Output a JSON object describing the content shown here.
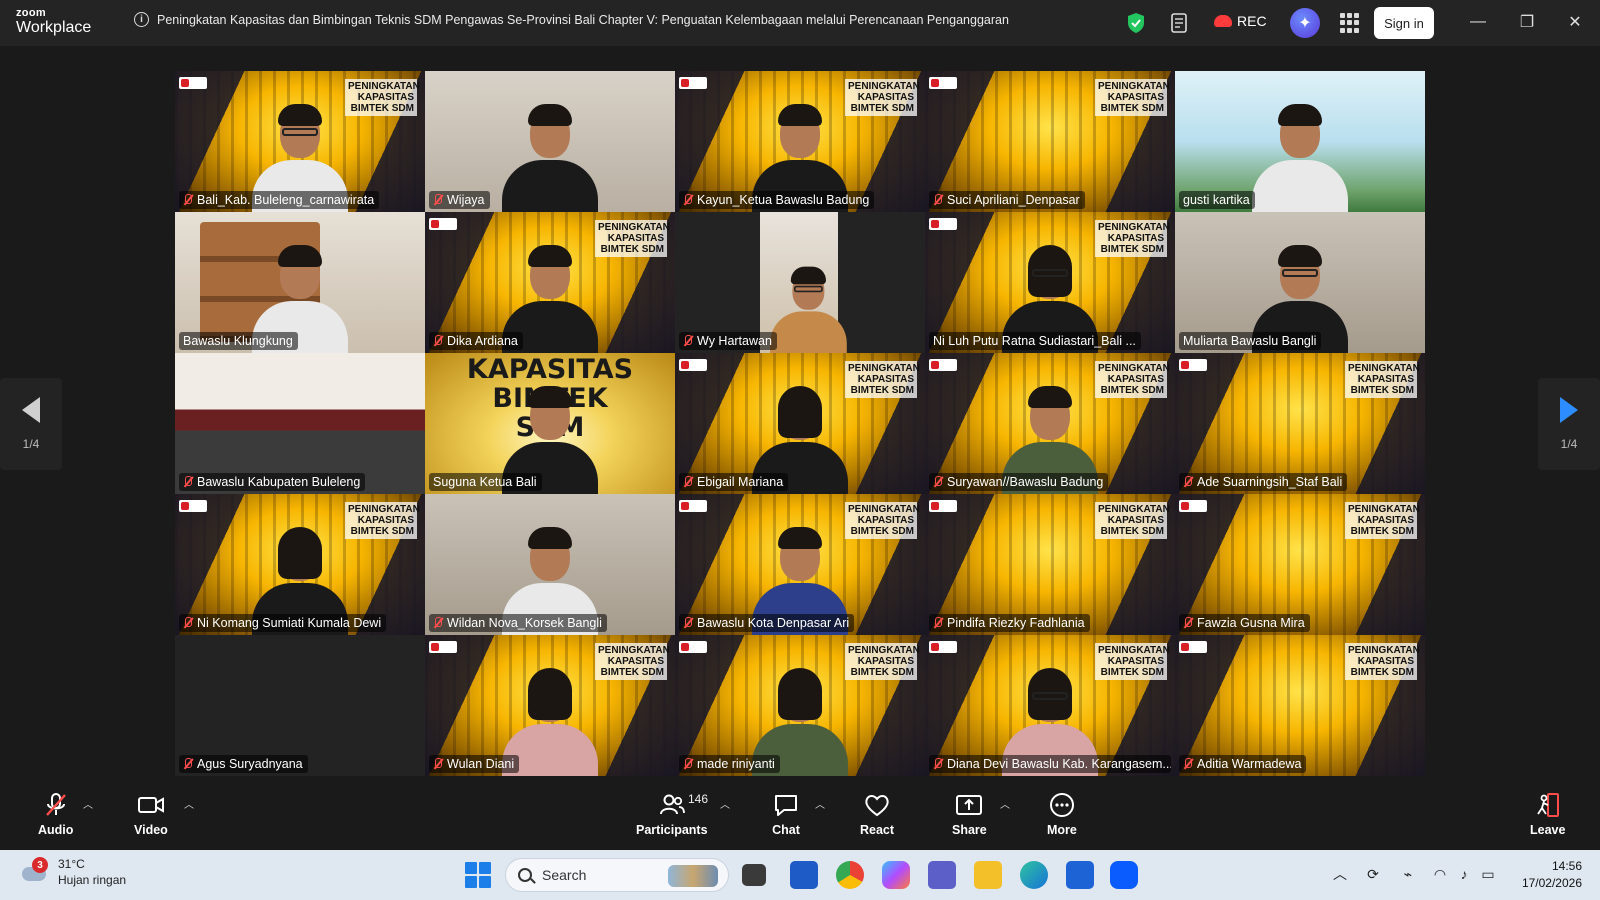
{
  "app": {
    "logo_line1": "zoom",
    "logo_line2": "Workplace",
    "meeting_title": "Peningkatan Kapasitas dan Bimbingan Teknis SDM Pengawas Se-Provinsi Bali Chapter V: Penguatan Kelembagaan melalui Perencanaan Penganggaran",
    "rec_label": "REC",
    "sign_in_label": "Sign in",
    "accent_color": "#2d8cff",
    "active_speaker_color": "#2bd46b",
    "muted_color": "#ff4d4d"
  },
  "banner": {
    "line1": "PENINGKATAN",
    "line2": "KAPASITAS",
    "line3": "BIMTEK SDM"
  },
  "kapasitas_tile": {
    "line1": "KAPASITAS",
    "line2": "BIMTEK SDM"
  },
  "participants": [
    {
      "name": "Bali_Kab. Buleleng_carnawirata",
      "muted": true,
      "bg": "banner",
      "look": "light glasses"
    },
    {
      "name": "Wijaya",
      "muted": true,
      "bg": "room",
      "look": "dark-shirt"
    },
    {
      "name": "Kayun_Ketua Bawaslu Badung",
      "muted": true,
      "bg": "banner",
      "look": "dark-shirt"
    },
    {
      "name": "Suci Apriliani_Denpasar",
      "muted": true,
      "bg": "banner",
      "look": "none"
    },
    {
      "name": "gusti kartika",
      "muted": false,
      "bg": "bali",
      "look": "light"
    },
    {
      "name": "Bawaslu Klungkung",
      "muted": false,
      "bg": "shelf",
      "look": "light"
    },
    {
      "name": "Dika Ardiana",
      "muted": true,
      "bg": "banner",
      "look": "dark-shirt"
    },
    {
      "name": "Wy Hartawan",
      "muted": true,
      "bg": "phone",
      "look": "orange glasses"
    },
    {
      "name": "Ni Luh Putu Ratna Sudiastari_Bali ...",
      "muted": false,
      "bg": "banner",
      "look": "long dark-shirt glasses",
      "active": true
    },
    {
      "name": "Muliarta Bawaslu Bangli",
      "muted": false,
      "bg": "blur",
      "look": "dark-shirt glasses"
    },
    {
      "name": "Bawaslu Kabupaten Buleleng",
      "muted": true,
      "bg": "meeting",
      "look": "none"
    },
    {
      "name": "Suguna Ketua Bali",
      "muted": false,
      "bg": "kapasitas",
      "look": "dark-shirt"
    },
    {
      "name": "Ebigail Mariana",
      "muted": true,
      "bg": "banner",
      "look": "long dark-shirt"
    },
    {
      "name": "Suryawan//Bawaslu Badung",
      "muted": true,
      "bg": "banner",
      "look": "green"
    },
    {
      "name": "Ade Suarningsih_Staf Bali",
      "muted": true,
      "bg": "banner",
      "look": "none"
    },
    {
      "name": "Ni Komang Sumiati Kumala Dewi",
      "muted": true,
      "bg": "banner",
      "look": "long dark-shirt"
    },
    {
      "name": "Wildan Nova_Korsek Bangli",
      "muted": true,
      "bg": "blur",
      "look": "light"
    },
    {
      "name": "Bawaslu Kota Denpasar Ari",
      "muted": true,
      "bg": "banner",
      "look": "blue"
    },
    {
      "name": "Pindifa Riezky Fadhlania",
      "muted": true,
      "bg": "banner",
      "look": "none"
    },
    {
      "name": "Fawzia Gusna Mira",
      "muted": true,
      "bg": "banner",
      "look": "none"
    },
    {
      "name": "Agus Suryadnyana",
      "muted": true,
      "bg": "dark",
      "look": "none"
    },
    {
      "name": "Wulan Diani",
      "muted": true,
      "bg": "banner",
      "look": "long pink"
    },
    {
      "name": "made riniyanti",
      "muted": true,
      "bg": "banner",
      "look": "long green"
    },
    {
      "name": "Diana Devi Bawaslu Kab. Karangasem...",
      "muted": true,
      "bg": "banner",
      "look": "long pink glasses"
    },
    {
      "name": "Aditia Warmadewa",
      "muted": true,
      "bg": "banner",
      "look": "none"
    }
  ],
  "pagination": {
    "left_label": "1/4",
    "right_label": "1/4"
  },
  "toolbar": {
    "audio_label": "Audio",
    "video_label": "Video",
    "participants_label": "Participants",
    "participants_count": "146",
    "chat_label": "Chat",
    "react_label": "React",
    "share_label": "Share",
    "more_label": "More",
    "leave_label": "Leave"
  },
  "taskbar": {
    "weather_temp": "31°C",
    "weather_desc": "Hujan ringan",
    "weather_badge": "3",
    "search_label": "Search",
    "time": "14:56",
    "date": "17/02/2026"
  }
}
